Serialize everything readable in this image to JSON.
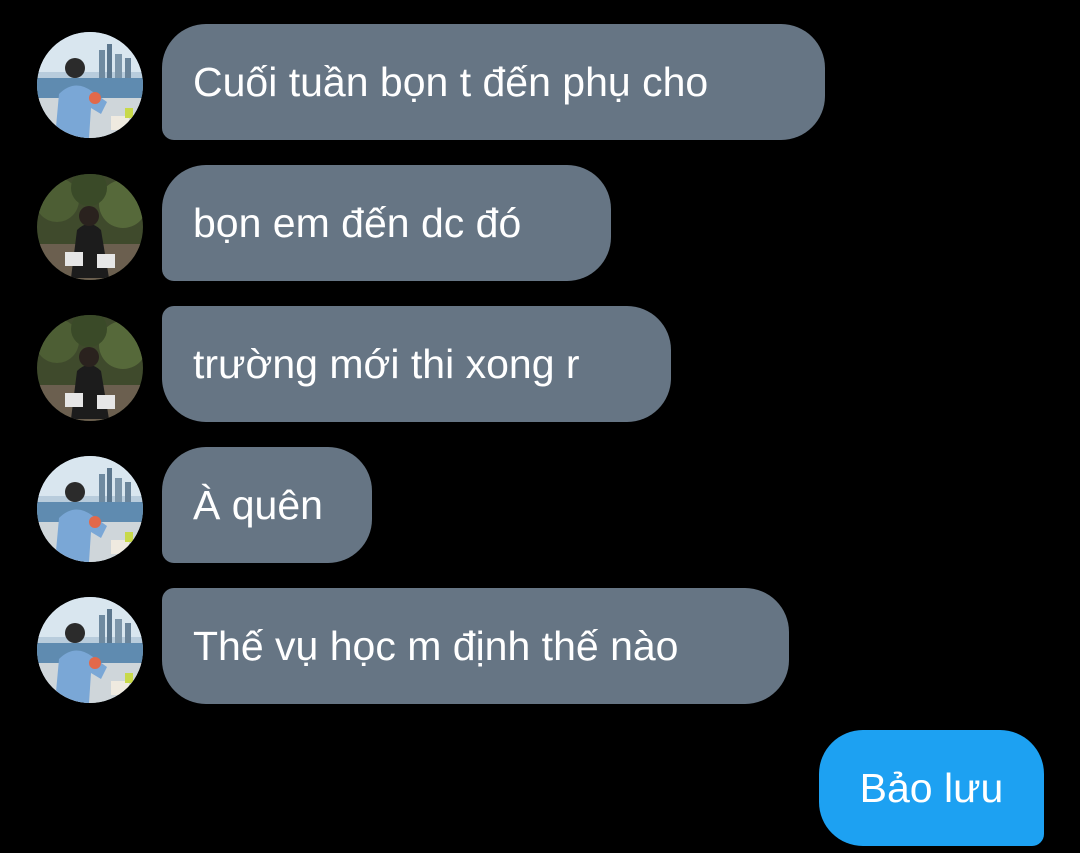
{
  "messages": [
    {
      "text": "Cuối tuần bọn t đến phụ cho",
      "sender": "contact-a"
    },
    {
      "text": "bọn em đến dc đó",
      "sender": "contact-b"
    },
    {
      "text": "trường mới thi xong r",
      "sender": "contact-b"
    },
    {
      "text": "À quên",
      "sender": "contact-a"
    },
    {
      "text": "Thế vụ học m định thế nào",
      "sender": "contact-a"
    }
  ],
  "sent_message": {
    "text": "Bảo lưu"
  },
  "colors": {
    "background": "#000000",
    "received_bubble": "#667584",
    "sent_bubble": "#1da1f2",
    "text": "#ffffff"
  },
  "icons": {
    "contact_a_avatar": "photo-person-by-harbor",
    "contact_b_avatar": "photo-person-sitting-in-garden"
  }
}
